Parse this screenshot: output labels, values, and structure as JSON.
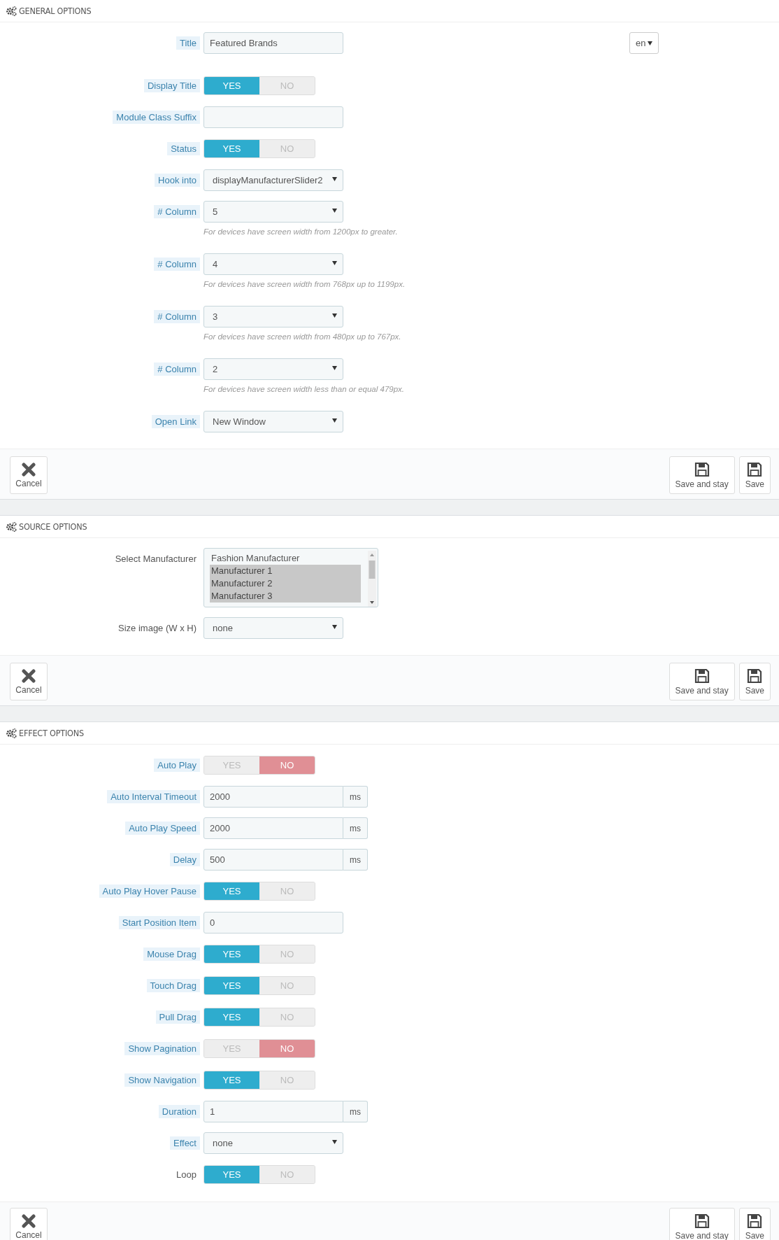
{
  "sections": [
    {
      "title": "GENERAL OPTIONS",
      "fields": [
        {
          "kind": "text",
          "label": "Title",
          "hint": true,
          "value": "Featured Brands",
          "language": "en"
        },
        {
          "kind": "toggle",
          "label": "Display Title",
          "hint": true,
          "options": [
            {
              "label": "YES",
              "selected": true
            },
            {
              "label": "NO",
              "selected": false
            }
          ]
        },
        {
          "kind": "text",
          "label": "Module Class Suffix",
          "hint": true
        },
        {
          "kind": "toggle",
          "label": "Status",
          "hint": true,
          "options": [
            {
              "label": "YES",
              "selected": true
            },
            {
              "label": "NO",
              "selected": false
            }
          ]
        },
        {
          "kind": "select",
          "label": "Hook into",
          "hint": true,
          "value": "displayManufacturerSlider2"
        },
        {
          "kind": "select",
          "label": "# Column",
          "hint": true,
          "value": "5",
          "help": "For devices have screen width from 1200px to greater."
        },
        {
          "kind": "select",
          "label": "# Column",
          "hint": true,
          "value": "4",
          "help": "For devices have screen width from 768px up to 1199px."
        },
        {
          "kind": "select",
          "label": "# Column",
          "hint": true,
          "value": "3",
          "help": "For devices have screen width from 480px up to 767px."
        },
        {
          "kind": "select",
          "label": "# Column",
          "hint": true,
          "value": "2",
          "help": "For devices have screen width less than or equal 479px."
        },
        {
          "kind": "select",
          "label": "Open Link",
          "hint": true,
          "value": "New Window"
        }
      ],
      "buttons": [
        {
          "kind": "cancel",
          "label": "Cancel"
        },
        {
          "kind": "save",
          "label": "Save and stay"
        },
        {
          "kind": "save",
          "label": "Save"
        }
      ]
    },
    {
      "title": "SOURCE OPTIONS",
      "fields": [
        {
          "kind": "listbox",
          "label": "Select Manufacturer",
          "hint": false,
          "options": [
            {
              "label": "Fashion Manufacturer",
              "selected": false
            },
            {
              "label": "Manufacturer 1",
              "selected": true
            },
            {
              "label": "Manufacturer 2",
              "selected": true
            },
            {
              "label": "Manufacturer 3",
              "selected": true
            }
          ]
        },
        {
          "kind": "select",
          "label": "Size image (W x H)",
          "hint": false,
          "value": "none"
        }
      ],
      "buttons": [
        {
          "kind": "cancel",
          "label": "Cancel"
        },
        {
          "kind": "save",
          "label": "Save and stay"
        },
        {
          "kind": "save",
          "label": "Save"
        }
      ]
    },
    {
      "title": "EFFECT OPTIONS",
      "fields": [
        {
          "kind": "toggle",
          "label": "Auto Play",
          "hint": true,
          "options": [
            {
              "label": "YES",
              "selected": false
            },
            {
              "label": "NO",
              "selected": true
            }
          ]
        },
        {
          "kind": "addon",
          "label": "Auto Interval Timeout",
          "hint": true,
          "value": "2000",
          "unit": "ms"
        },
        {
          "kind": "addon",
          "label": "Auto Play Speed",
          "hint": true,
          "value": "2000",
          "unit": "ms"
        },
        {
          "kind": "addon",
          "label": "Delay",
          "hint": true,
          "value": "500",
          "unit": "ms"
        },
        {
          "kind": "toggle",
          "label": "Auto Play Hover Pause",
          "hint": true,
          "options": [
            {
              "label": "YES",
              "selected": true
            },
            {
              "label": "NO",
              "selected": false
            }
          ]
        },
        {
          "kind": "text",
          "label": "Start Position Item",
          "hint": true,
          "value": "0"
        },
        {
          "kind": "toggle",
          "label": "Mouse Drag",
          "hint": true,
          "options": [
            {
              "label": "YES",
              "selected": true
            },
            {
              "label": "NO",
              "selected": false
            }
          ]
        },
        {
          "kind": "toggle",
          "label": "Touch Drag",
          "hint": true,
          "options": [
            {
              "label": "YES",
              "selected": true
            },
            {
              "label": "NO",
              "selected": false
            }
          ]
        },
        {
          "kind": "toggle",
          "label": "Pull Drag",
          "hint": true,
          "options": [
            {
              "label": "YES",
              "selected": true
            },
            {
              "label": "NO",
              "selected": false
            }
          ]
        },
        {
          "kind": "toggle",
          "label": "Show Pagination",
          "hint": true,
          "options": [
            {
              "label": "YES",
              "selected": false
            },
            {
              "label": "NO",
              "selected": true
            }
          ]
        },
        {
          "kind": "toggle",
          "label": "Show Navigation",
          "hint": true,
          "options": [
            {
              "label": "YES",
              "selected": true
            },
            {
              "label": "NO",
              "selected": false
            }
          ]
        },
        {
          "kind": "addon",
          "label": "Duration",
          "hint": true,
          "value": "1",
          "unit": "ms"
        },
        {
          "kind": "select",
          "label": "Effect",
          "hint": true,
          "value": "none"
        },
        {
          "kind": "toggle",
          "label": "Loop",
          "hint": false,
          "options": [
            {
              "label": "YES",
              "selected": true
            },
            {
              "label": "NO",
              "selected": false
            }
          ]
        }
      ],
      "buttons": [
        {
          "kind": "cancel",
          "label": "Cancel"
        },
        {
          "kind": "save",
          "label": "Save and stay"
        },
        {
          "kind": "save",
          "label": "Save"
        }
      ]
    }
  ]
}
